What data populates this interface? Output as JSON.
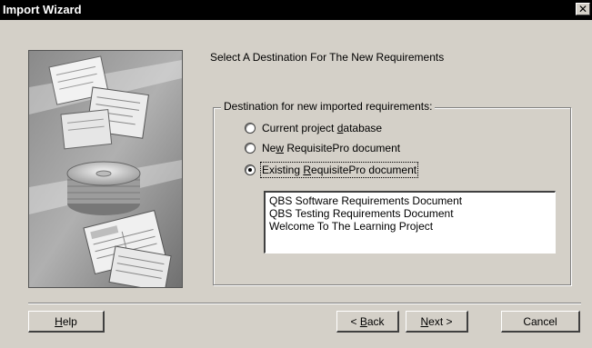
{
  "window": {
    "title": "Import Wizard",
    "close_glyph": "✕"
  },
  "page": {
    "heading": "Select A Destination For The New Requirements"
  },
  "destination": {
    "legend": "Destination for new imported requirements:",
    "options": [
      {
        "pre": "Current project ",
        "mnemonic": "d",
        "post": "atabase",
        "selected": false
      },
      {
        "pre": "Ne",
        "mnemonic": "w",
        "post": " RequisitePro document",
        "selected": false
      },
      {
        "pre": "Existing ",
        "mnemonic": "R",
        "post": "equisitePro document",
        "selected": true
      }
    ],
    "documents": [
      "QBS Software Requirements Document",
      "QBS Testing Requirements Document",
      "Welcome To The Learning Project"
    ]
  },
  "buttons": {
    "help": {
      "mnemonic": "H",
      "post": "elp"
    },
    "back": {
      "pre": "< ",
      "mnemonic": "B",
      "post": "ack"
    },
    "next": {
      "mnemonic": "N",
      "post": "ext >"
    },
    "cancel": {
      "label": "Cancel"
    }
  }
}
